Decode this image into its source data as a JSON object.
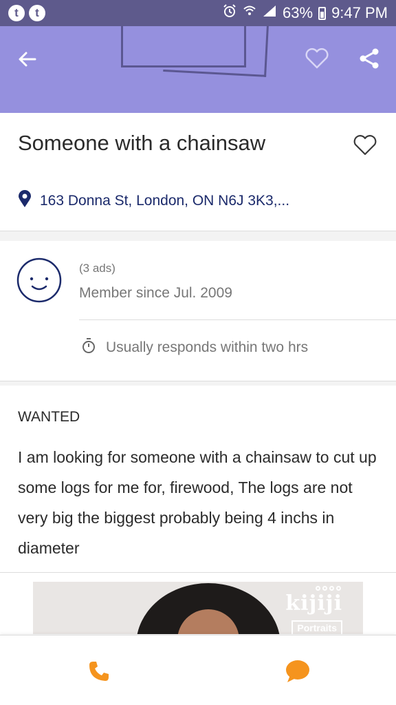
{
  "status_bar": {
    "left_icons": [
      "t",
      "t"
    ],
    "battery": "63%",
    "time": "9:47 PM"
  },
  "header": {
    "icons": [
      "back-arrow-icon",
      "heart-outline-icon",
      "share-icon"
    ]
  },
  "ad": {
    "title": "Someone with a chainsaw",
    "location": "163 Donna St, London, ON N6J 3K3,...",
    "type": "WANTED",
    "description": "I am looking for someone with a chainsaw to cut up some logs for me for, firewood, The logs are not very big the biggest probably being 4 inchs in diameter"
  },
  "seller": {
    "ads_count": "(3 ads)",
    "member_since": "Member since Jul. 2009",
    "responds": "Usually responds within two hrs"
  },
  "promo": {
    "logo": "kijiji",
    "sub": "Portraits"
  },
  "colors": {
    "status_bar": "#5e5a8c",
    "header": "#9590de",
    "accent_orange": "#f5941e",
    "location_blue": "#1b2a6b"
  },
  "bottom_bar": {
    "icons": [
      "phone-icon",
      "chat-bubble-icon"
    ]
  }
}
